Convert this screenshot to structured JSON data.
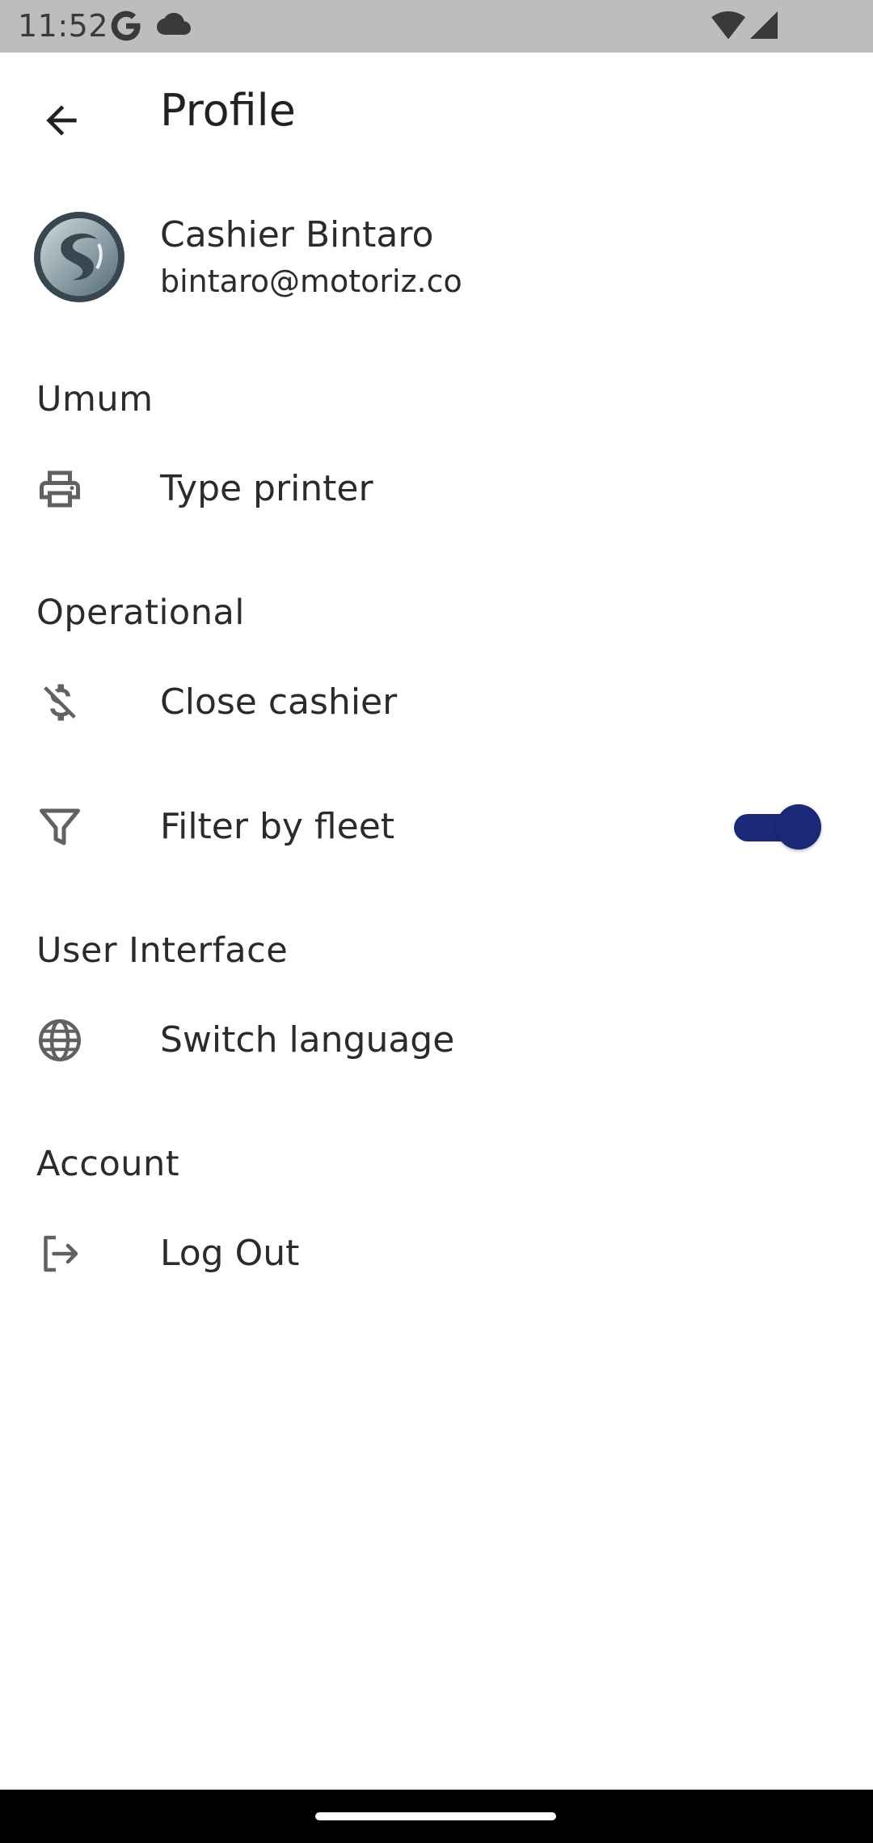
{
  "status_bar": {
    "time": "11:52",
    "icons": [
      "google-g-icon",
      "cloud-icon",
      "wifi-icon",
      "signal-icon"
    ]
  },
  "app_bar": {
    "back_icon": "arrow-back-icon",
    "title": "Profile"
  },
  "profile": {
    "name": "Cashier Bintaro",
    "email": "bintaro@motoriz.co",
    "avatar_icon": "company-logo-avatar"
  },
  "sections": {
    "general": {
      "header": "Umum",
      "items": [
        {
          "label": "Type printer",
          "icon": "printer-icon"
        }
      ]
    },
    "operational": {
      "header": "Operational",
      "items": [
        {
          "label": "Close cashier",
          "icon": "money-off-icon"
        },
        {
          "label": "Filter by fleet",
          "icon": "filter-icon",
          "toggle": true
        }
      ]
    },
    "user_interface": {
      "header": "User Interface",
      "items": [
        {
          "label": "Switch language",
          "icon": "globe-icon"
        }
      ]
    },
    "account": {
      "header": "Account",
      "items": [
        {
          "label": "Log Out",
          "icon": "logout-icon"
        }
      ]
    }
  },
  "colors": {
    "status_bar": "#bdbdbd",
    "toggle_active": "#1b2a78",
    "icon_gray": "#616161",
    "text": "#2b2b2b",
    "nav_bar": "#000000"
  }
}
